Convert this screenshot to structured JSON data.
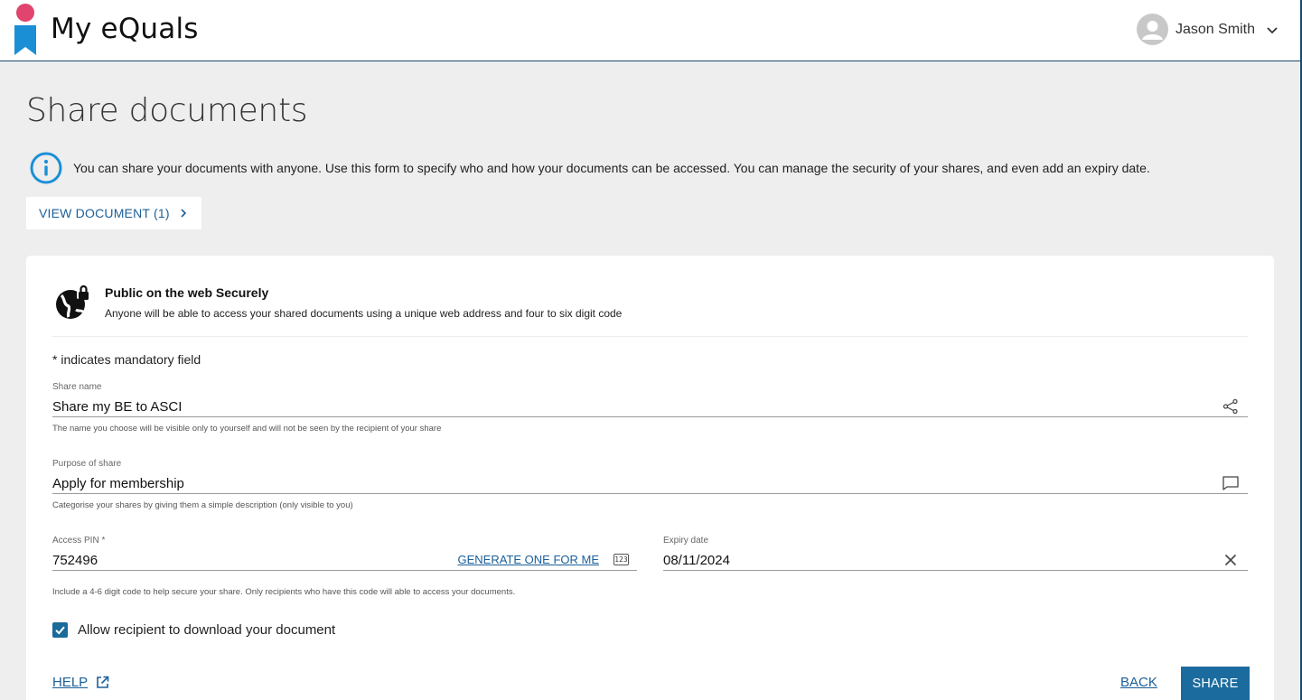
{
  "header": {
    "brand": "My eQuals",
    "user_name": "Jason Smith"
  },
  "page": {
    "title": "Share documents",
    "info": "You can share your documents with anyone. Use this form to specify who and how your documents can be accessed. You can manage the security of your shares, and even add an expiry date.",
    "view_document_label": "VIEW DOCUMENT (1)"
  },
  "share_type": {
    "title": "Public on the web Securely",
    "description": "Anyone will be able to access your shared documents using a unique web address and four to six digit code"
  },
  "form": {
    "mandatory_note": "* indicates mandatory field",
    "share_name": {
      "label": "Share name",
      "value": "Share my BE to ASCI",
      "help": "The name you choose will be visible only to yourself and will not be seen by the recipient of your share"
    },
    "purpose": {
      "label": "Purpose of share",
      "value": "Apply for membership",
      "help": "Categorise your shares by giving them a simple description (only visible to you)"
    },
    "access_pin": {
      "label": "Access PIN *",
      "value": "752496",
      "generate_label": "GENERATE ONE FOR ME",
      "keyboard_icon_text": "123",
      "help": "Include a 4-6 digit code to help secure your share. Only recipients who have this code will able to access your documents."
    },
    "expiry": {
      "label": "Expiry date",
      "value": "08/11/2024"
    },
    "allow_download": {
      "label": "Allow recipient to download your document",
      "checked": true
    }
  },
  "actions": {
    "help_label": "HELP",
    "back_label": "BACK",
    "share_label": "SHARE"
  },
  "colors": {
    "brand_blue": "#1b8fd6",
    "brand_pink": "#e0446f",
    "link_blue": "#1a5f9a",
    "primary_button": "#1b6b9e",
    "page_background": "#eeeeee"
  },
  "icons": {
    "logo": "bookmark-dot-logo",
    "avatar": "user-avatar-icon",
    "info": "info-circle-icon",
    "globe": "globe-lock-icon",
    "share": "share-icon",
    "comment": "comment-icon",
    "keyboard": "keyboard-number-icon",
    "clear": "close-icon",
    "external": "external-link-icon"
  }
}
